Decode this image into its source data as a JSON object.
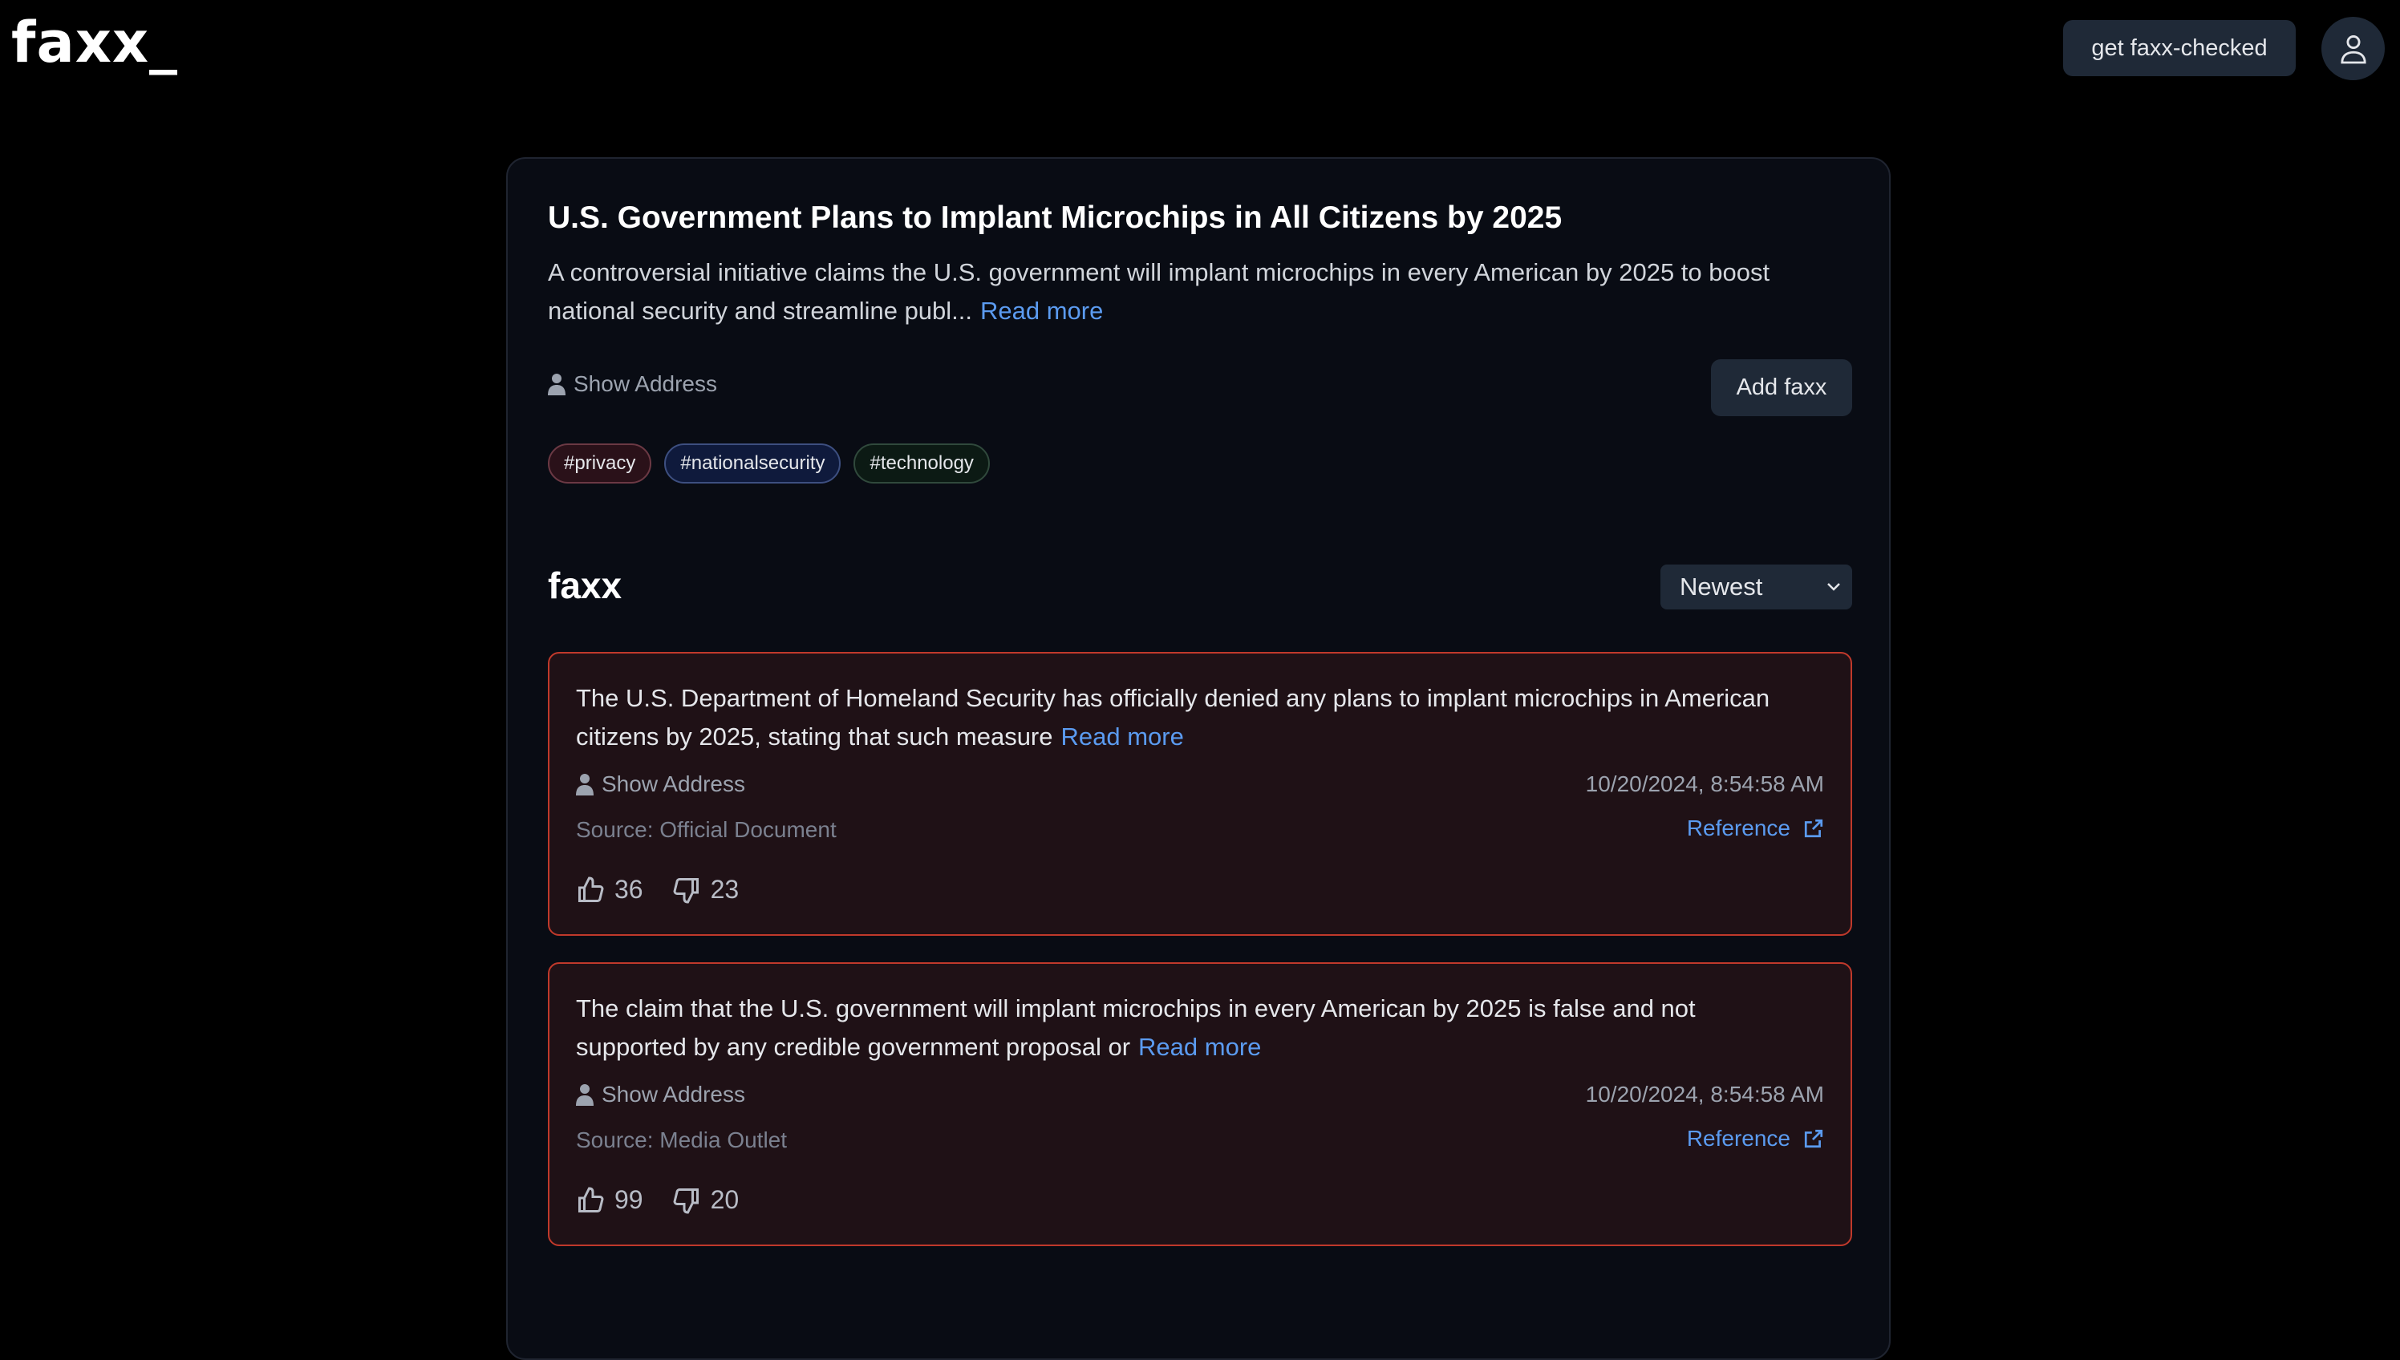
{
  "header": {
    "logo": "faxx_",
    "cta_label": "get faxx-checked",
    "profile_icon": "user-icon"
  },
  "post": {
    "title": "U.S. Government Plans to Implant Microchips in All Citizens by 2025",
    "description": "A controversial initiative claims the U.S. government will implant microchips in every American by 2025 to boost national security and streamline publ...",
    "read_more": "Read more",
    "show_address": "Show Address",
    "add_label": "Add faxx",
    "tags": [
      {
        "label": "#privacy",
        "bg": "#2a1119",
        "border": "#6b3944"
      },
      {
        "label": "#nationalsecurity",
        "bg": "#0f1a3c",
        "border": "#3d4f80"
      },
      {
        "label": "#technology",
        "bg": "#0c1a14",
        "border": "#30493c"
      }
    ]
  },
  "faxx": {
    "heading": "faxx",
    "sort": "Newest",
    "items": [
      {
        "text": "The U.S. Department of Homeland Security has officially denied any plans to implant microchips in American citizens by 2025, stating that such measure",
        "read_more": "Read more",
        "show_address": "Show Address",
        "date": "10/20/2024, 8:54:58 AM",
        "source": "Source: Official Document",
        "reference": "Reference",
        "upvotes": "36",
        "downvotes": "23"
      },
      {
        "text": "The claim that the U.S. government will implant microchips in every American by 2025 is false and not supported by any credible government proposal or",
        "read_more": "Read more",
        "show_address": "Show Address",
        "date": "10/20/2024, 8:54:58 AM",
        "source": "Source: Media Outlet",
        "reference": "Reference",
        "upvotes": "99",
        "downvotes": "20"
      }
    ]
  },
  "colors": {
    "accent": "#5b9bf0",
    "fact_border": "#c0392b",
    "card_bg": "#090c14"
  }
}
